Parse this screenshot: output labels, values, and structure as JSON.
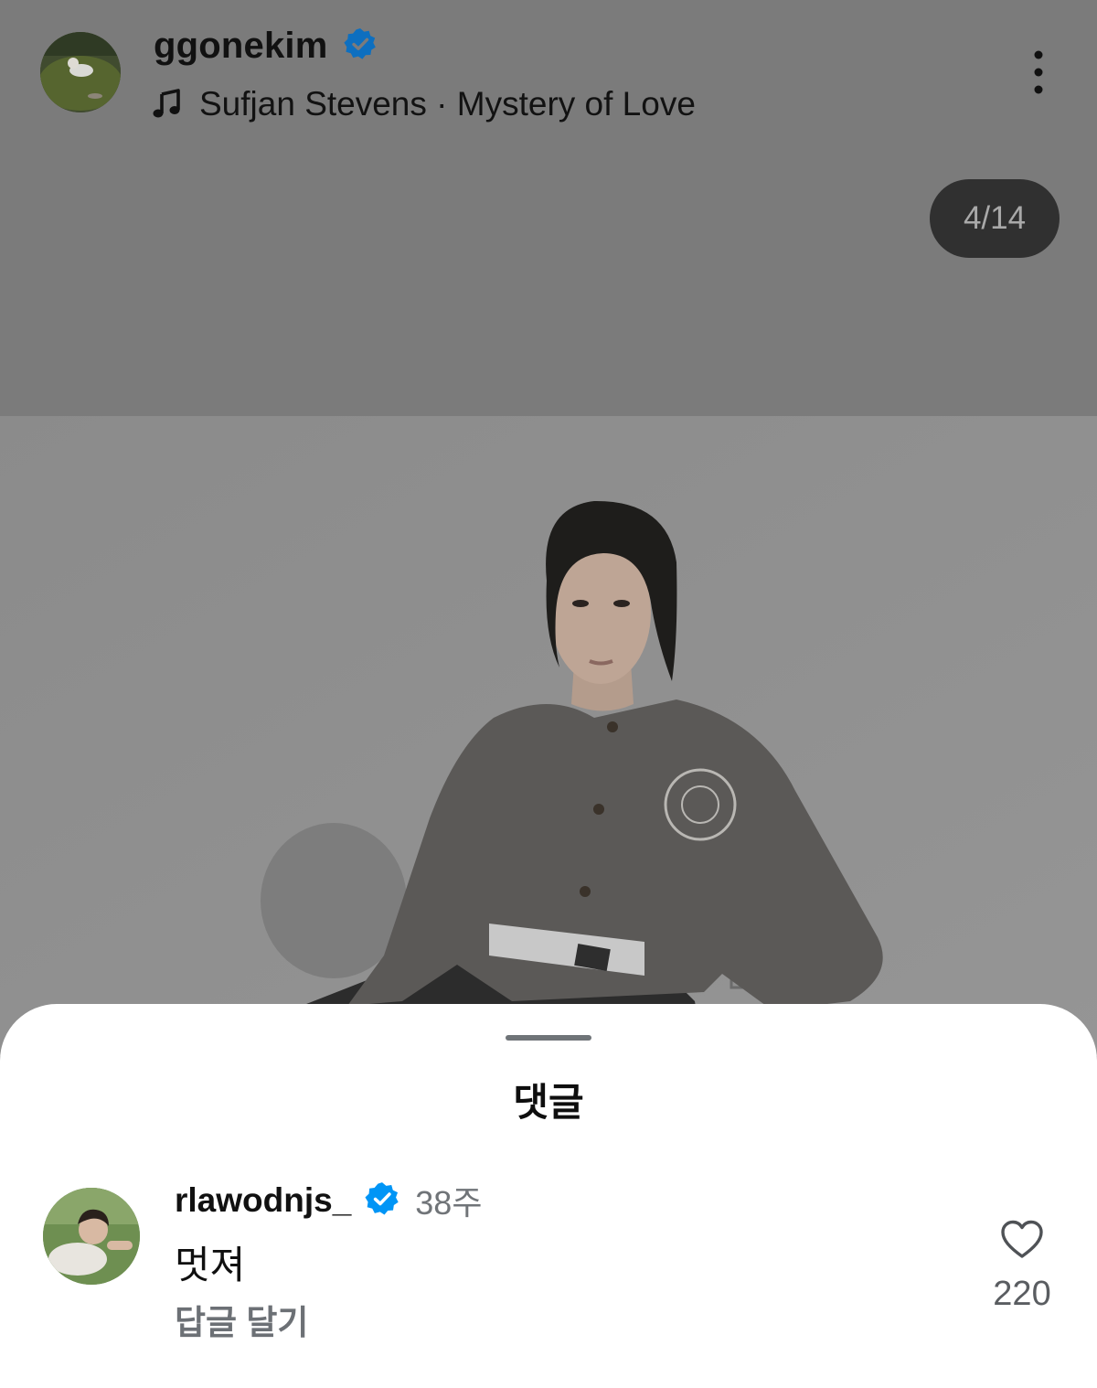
{
  "post": {
    "username": "ggonekim",
    "verified": true,
    "music": {
      "icon": "music-note-icon",
      "text": "Sufjan Stevens · Mystery of Love"
    },
    "page_counter": "4/14"
  },
  "comment_sheet": {
    "title": "댓글",
    "comments": [
      {
        "username": "rlawodnjs_",
        "verified": true,
        "time": "38주",
        "text": "멋져",
        "reply_label": "답글 달기",
        "like_count": "220"
      }
    ]
  },
  "colors": {
    "verified_blue": "#0095f6",
    "dim_overlay": "#7b7b7b",
    "counter_bg": "#303030"
  }
}
